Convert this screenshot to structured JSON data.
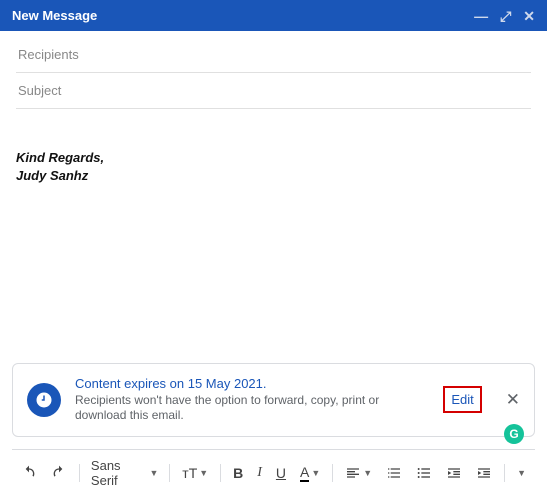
{
  "header": {
    "title": "New Message"
  },
  "fields": {
    "recipients_placeholder": "Recipients",
    "subject_placeholder": "Subject"
  },
  "signature": {
    "line1": "Kind Regards,",
    "line2": "Judy Sanhz"
  },
  "confidential": {
    "title": "Content expires on 15 May 2021.",
    "subtitle": "Recipients won't have the option to forward, copy, print or download this email.",
    "edit": "Edit"
  },
  "toolbar": {
    "font": "Sans Serif",
    "size_glyph": "тT",
    "bold": "B",
    "italic": "I",
    "underline": "U",
    "textcolor": "A"
  },
  "grammarly": "G"
}
